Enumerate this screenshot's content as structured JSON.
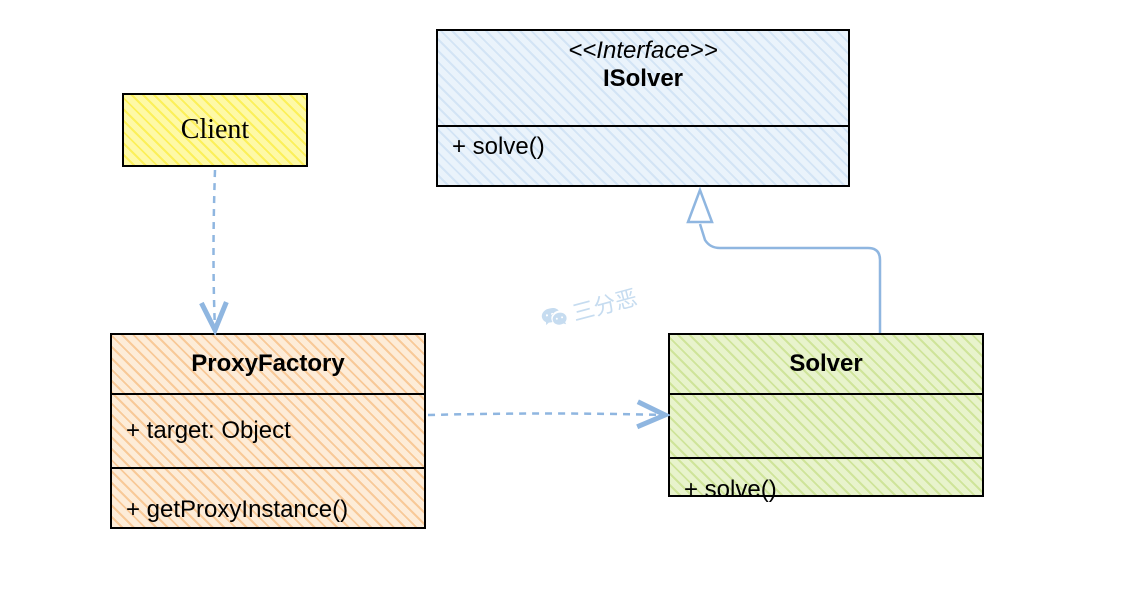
{
  "diagram": {
    "client": {
      "label": "Client"
    },
    "isolver": {
      "stereotype": "<<Interface>>",
      "name": "ISolver",
      "method": "+ solve()"
    },
    "proxyfactory": {
      "name": "ProxyFactory",
      "attr": "+ target: Object",
      "method": "+ getProxyInstance()"
    },
    "solver": {
      "name": "Solver",
      "method": "+ solve()"
    },
    "watermark": "三分恶",
    "relations": {
      "client_to_proxyfactory": {
        "type": "dependency_dashed_open_arrow"
      },
      "proxyfactory_to_solver": {
        "type": "dependency_dashed_open_arrow"
      },
      "solver_to_isolver": {
        "type": "realization_hollow_triangle"
      }
    }
  }
}
